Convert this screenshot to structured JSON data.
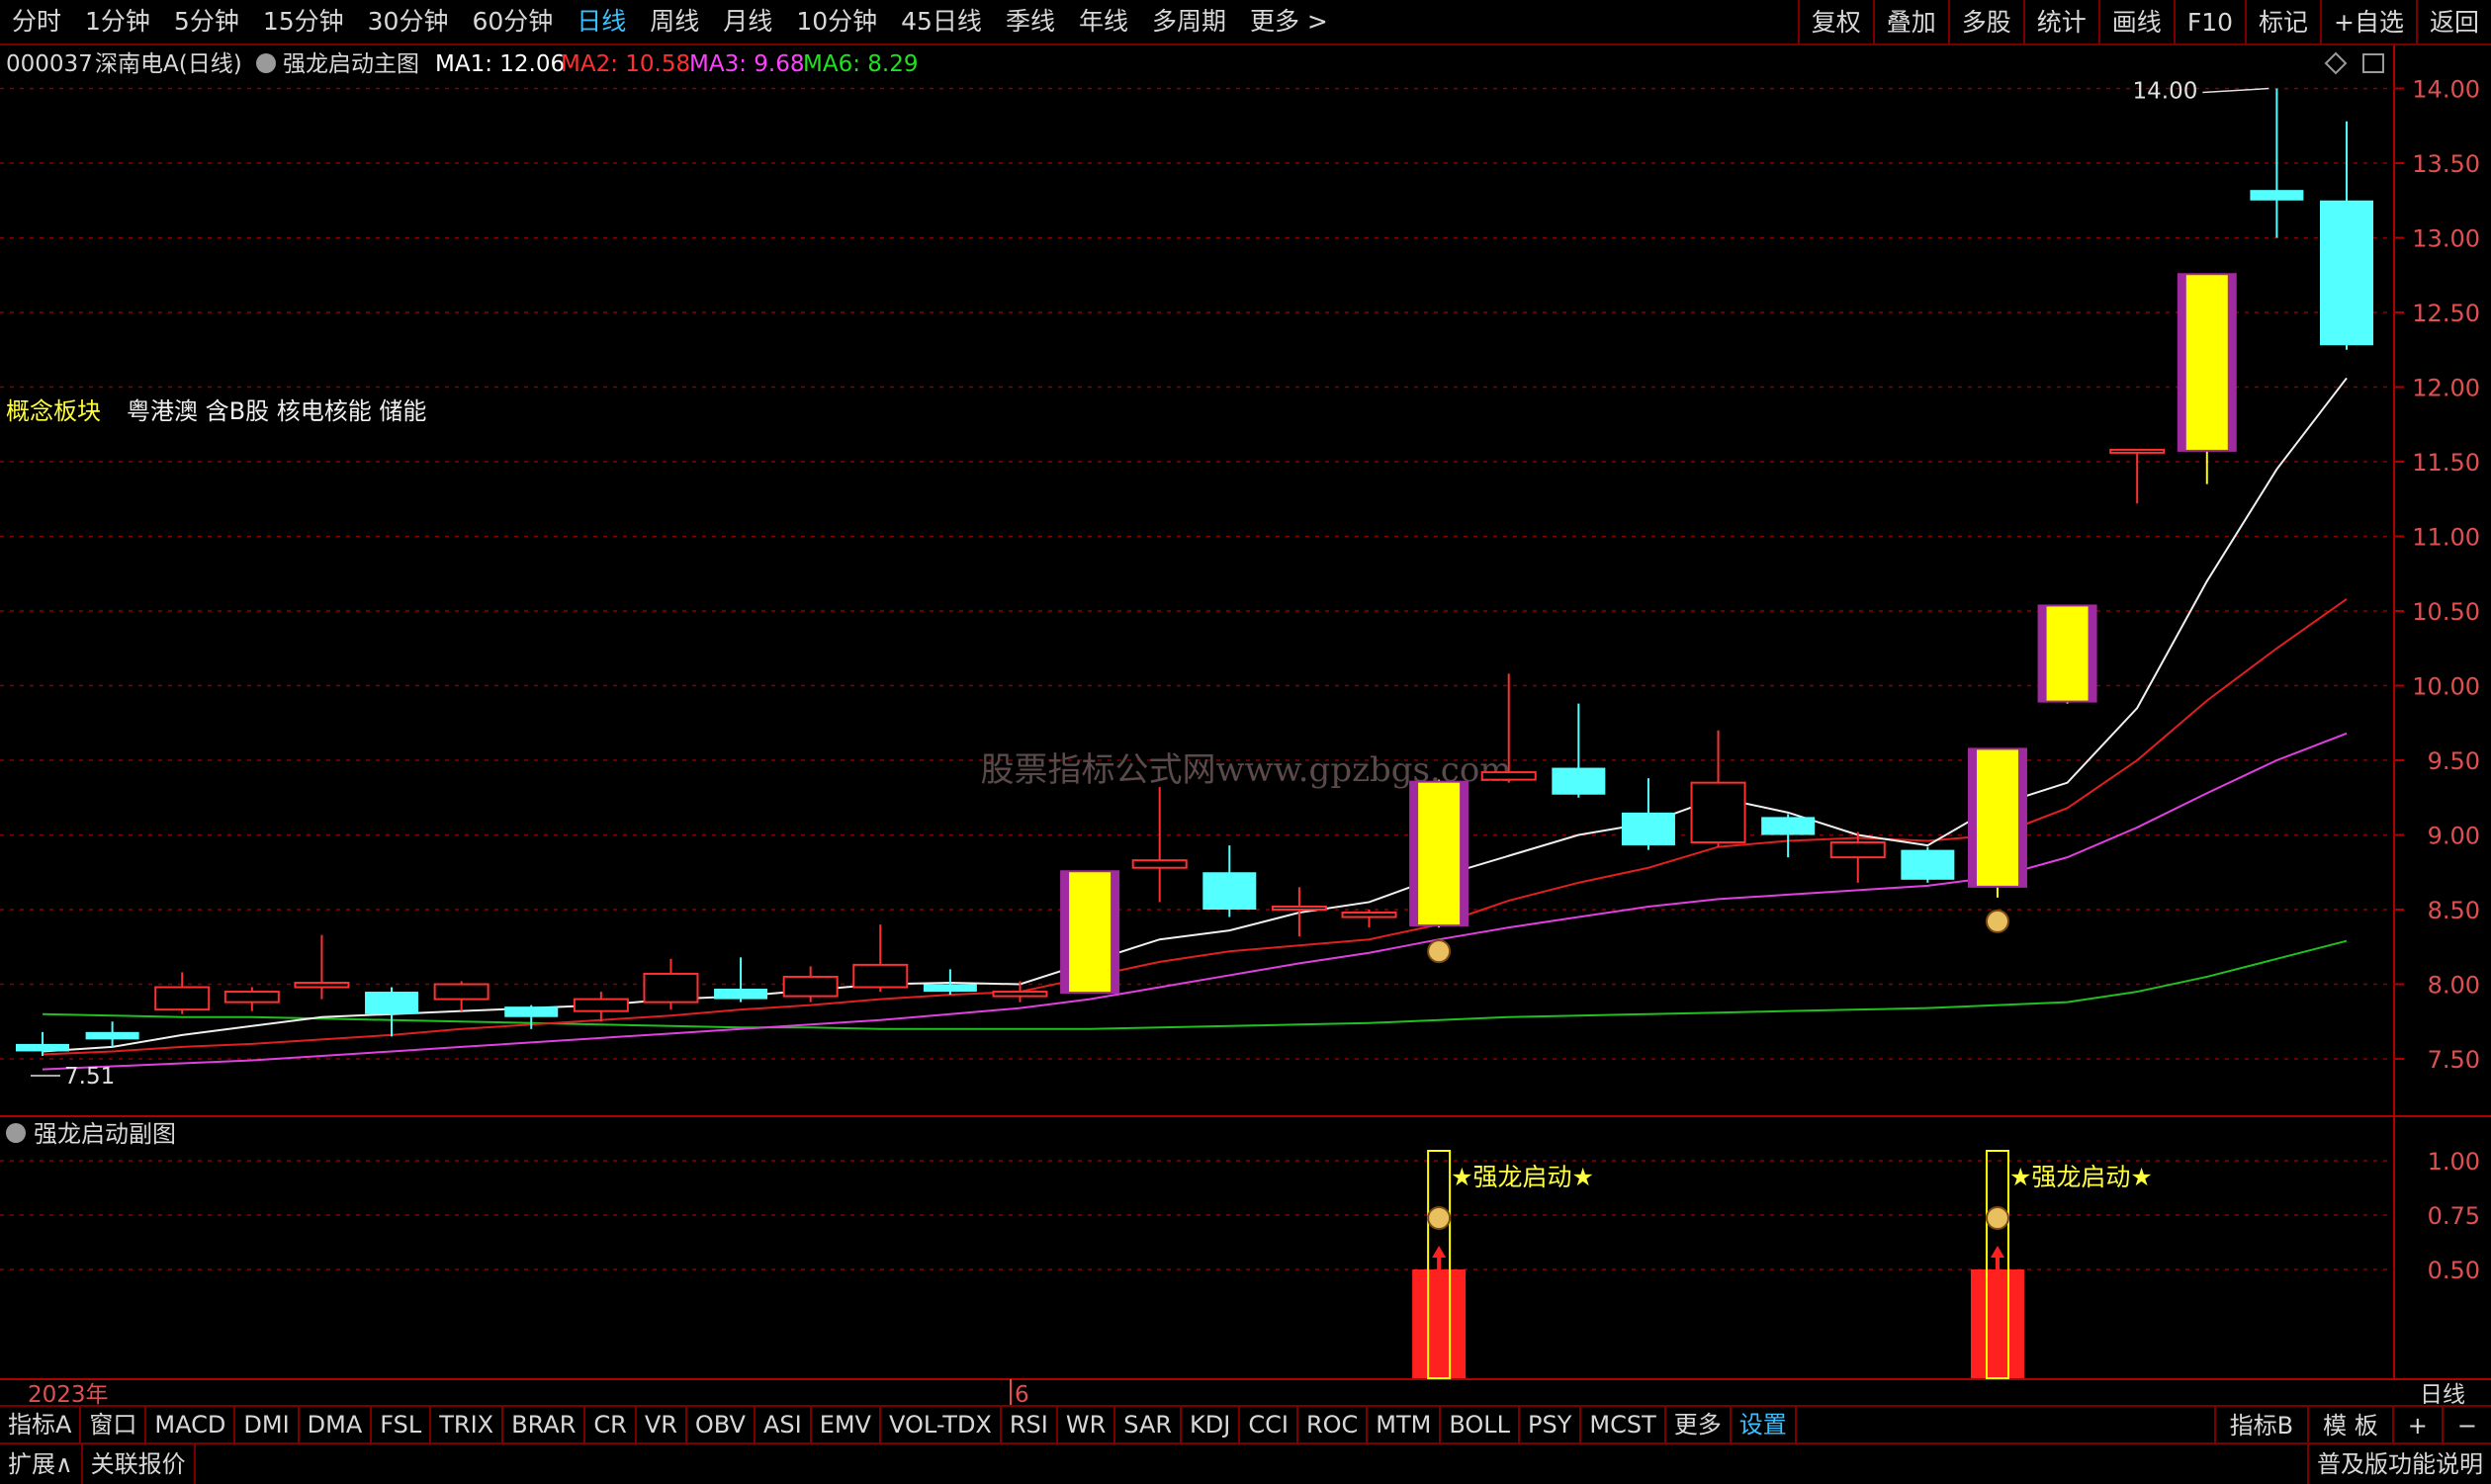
{
  "topbar": {
    "tabs": [
      "分时",
      "1分钟",
      "5分钟",
      "15分钟",
      "30分钟",
      "60分钟",
      "日线",
      "周线",
      "月线",
      "10分钟",
      "45日线",
      "季线",
      "年线",
      "多周期",
      "更多 >"
    ],
    "active_index": 6,
    "right_buttons": [
      "复权",
      "叠加",
      "多股",
      "统计",
      "画线",
      "F10",
      "标记",
      "+自选",
      "返回"
    ]
  },
  "main_chart": {
    "stock_code": "000037",
    "stock_name": "深南电A(日线)",
    "formula_name": "强龙启动主图",
    "ma": [
      {
        "label": "MA1: 12.06",
        "color": "#ffffff"
      },
      {
        "label": "MA2: 10.58",
        "color": "#ff3030"
      },
      {
        "label": "MA3: 9.68",
        "color": "#ff40ff"
      },
      {
        "label": "MA6: 8.29",
        "color": "#20e020"
      }
    ],
    "concept_label": "概念板块",
    "concept_value": "粤港澳 含B股 核电核能 储能",
    "high_label": "14.00",
    "low_label": "7.51",
    "y_axis": [
      14.0,
      13.5,
      13.0,
      12.5,
      12.0,
      11.5,
      11.0,
      10.5,
      10.0,
      9.5,
      9.0,
      8.5,
      8.0,
      7.5
    ],
    "watermark": "股票指标公式网www.gpzbgs.com"
  },
  "sub_chart": {
    "title": "强龙启动副图",
    "y_axis": [
      1.0,
      0.75,
      0.5
    ],
    "signal_label": "★强龙启动★"
  },
  "time_axis": {
    "year_label": "2023年",
    "month_label": "6",
    "period": "日线"
  },
  "chart_data": {
    "type": "candlestick",
    "candles": [
      {
        "o": 7.6,
        "c": 7.55,
        "h": 7.68,
        "l": 7.52
      },
      {
        "o": 7.68,
        "c": 7.63,
        "h": 7.75,
        "l": 7.58
      },
      {
        "o": 7.83,
        "c": 7.98,
        "h": 8.08,
        "l": 7.8
      },
      {
        "o": 7.88,
        "c": 7.95,
        "h": 7.98,
        "l": 7.82
      },
      {
        "o": 7.98,
        "c": 8.01,
        "h": 8.33,
        "l": 7.9
      },
      {
        "o": 7.95,
        "c": 7.8,
        "h": 7.98,
        "l": 7.65
      },
      {
        "o": 7.9,
        "c": 8.0,
        "h": 8.02,
        "l": 7.82
      },
      {
        "o": 7.85,
        "c": 7.78,
        "h": 7.86,
        "l": 7.7
      },
      {
        "o": 7.82,
        "c": 7.9,
        "h": 7.95,
        "l": 7.75
      },
      {
        "o": 7.88,
        "c": 8.07,
        "h": 8.17,
        "l": 7.83
      },
      {
        "o": 7.97,
        "c": 7.9,
        "h": 8.18,
        "l": 7.88
      },
      {
        "o": 7.92,
        "c": 8.05,
        "h": 8.12,
        "l": 7.88
      },
      {
        "o": 7.98,
        "c": 8.13,
        "h": 8.4,
        "l": 7.95
      },
      {
        "o": 8.0,
        "c": 7.95,
        "h": 8.1,
        "l": 7.93
      },
      {
        "o": 7.92,
        "c": 7.95,
        "h": 8.02,
        "l": 7.88
      },
      {
        "o": 7.95,
        "c": 8.75,
        "h": 8.75,
        "l": 7.95,
        "signal": true
      },
      {
        "o": 8.78,
        "c": 8.83,
        "h": 9.32,
        "l": 8.55
      },
      {
        "o": 8.75,
        "c": 8.5,
        "h": 8.93,
        "l": 8.45
      },
      {
        "o": 8.5,
        "c": 8.52,
        "h": 8.65,
        "l": 8.32
      },
      {
        "o": 8.45,
        "c": 8.48,
        "h": 8.5,
        "l": 8.38
      },
      {
        "o": 8.4,
        "c": 9.35,
        "h": 9.37,
        "l": 8.38,
        "signal": true,
        "money": true
      },
      {
        "o": 9.37,
        "c": 9.42,
        "h": 10.08,
        "l": 9.35
      },
      {
        "o": 9.45,
        "c": 9.27,
        "h": 9.88,
        "l": 9.25
      },
      {
        "o": 9.15,
        "c": 8.93,
        "h": 9.38,
        "l": 8.9
      },
      {
        "o": 8.95,
        "c": 9.35,
        "h": 9.7,
        "l": 8.92
      },
      {
        "o": 9.12,
        "c": 9.0,
        "h": 9.14,
        "l": 8.85
      },
      {
        "o": 8.85,
        "c": 8.95,
        "h": 9.02,
        "l": 8.68
      },
      {
        "o": 8.9,
        "c": 8.7,
        "h": 8.92,
        "l": 8.68
      },
      {
        "o": 8.66,
        "c": 9.57,
        "h": 9.57,
        "l": 8.58,
        "signal": true,
        "money": true
      },
      {
        "o": 9.9,
        "c": 10.53,
        "h": 10.53,
        "l": 9.88,
        "signal": true
      },
      {
        "o": 11.58,
        "c": 11.58,
        "h": 11.58,
        "l": 11.22
      },
      {
        "o": 11.58,
        "c": 12.75,
        "h": 12.75,
        "l": 11.35,
        "signal": true
      },
      {
        "o": 13.32,
        "c": 13.25,
        "h": 14.0,
        "l": 13.0
      },
      {
        "o": 13.25,
        "c": 12.28,
        "h": 13.78,
        "l": 12.25
      }
    ],
    "ma1": [
      7.55,
      7.58,
      7.66,
      7.72,
      7.78,
      7.8,
      7.82,
      7.84,
      7.86,
      7.9,
      7.92,
      7.96,
      8.0,
      8.01,
      8.0,
      8.15,
      8.3,
      8.36,
      8.48,
      8.55,
      8.72,
      8.86,
      9.0,
      9.08,
      9.25,
      9.15,
      9.0,
      8.93,
      9.2,
      9.35,
      9.85,
      10.7,
      11.45,
      12.06
    ],
    "ma2": [
      7.53,
      7.55,
      7.58,
      7.6,
      7.63,
      7.66,
      7.7,
      7.73,
      7.76,
      7.79,
      7.83,
      7.86,
      7.9,
      7.93,
      7.95,
      8.05,
      8.15,
      8.22,
      8.26,
      8.3,
      8.4,
      8.56,
      8.68,
      8.78,
      8.92,
      8.96,
      8.98,
      8.96,
      9.0,
      9.18,
      9.5,
      9.9,
      10.25,
      10.58
    ],
    "ma3": [
      7.43,
      7.45,
      7.47,
      7.49,
      7.52,
      7.55,
      7.58,
      7.61,
      7.64,
      7.67,
      7.7,
      7.73,
      7.76,
      7.8,
      7.84,
      7.9,
      7.98,
      8.06,
      8.14,
      8.21,
      8.3,
      8.38,
      8.45,
      8.52,
      8.57,
      8.6,
      8.63,
      8.66,
      8.72,
      8.85,
      9.05,
      9.28,
      9.5,
      9.68
    ],
    "ma6": [
      7.8,
      7.79,
      7.78,
      7.78,
      7.77,
      7.76,
      7.75,
      7.74,
      7.73,
      7.72,
      7.71,
      7.71,
      7.7,
      7.7,
      7.7,
      7.7,
      7.71,
      7.72,
      7.73,
      7.74,
      7.76,
      7.78,
      7.79,
      7.8,
      7.81,
      7.82,
      7.83,
      7.84,
      7.86,
      7.88,
      7.95,
      8.05,
      8.17,
      8.29
    ],
    "sub_signals": [
      {
        "index": 20,
        "value": 0.5
      },
      {
        "index": 28,
        "value": 0.5
      }
    ]
  },
  "indicator_tabs": [
    "指标A",
    "窗口",
    "MACD",
    "DMI",
    "DMA",
    "FSL",
    "TRIX",
    "BRAR",
    "CR",
    "VR",
    "OBV",
    "ASI",
    "EMV",
    "VOL-TDX",
    "RSI",
    "WR",
    "SAR",
    "KDJ",
    "CCI",
    "ROC",
    "MTM",
    "BOLL",
    "PSY",
    "MCST",
    "更多",
    "设置"
  ],
  "indicator_tabs_right": [
    "指标B",
    "模 板",
    "+",
    "−"
  ],
  "statusbar": {
    "left": [
      "扩展∧",
      "关联报价"
    ],
    "right": "普及版功能说明"
  }
}
